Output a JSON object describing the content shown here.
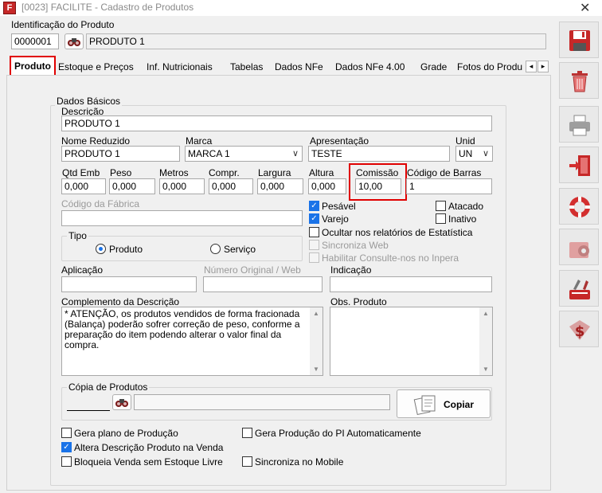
{
  "window": {
    "title": "[0023] FACILITE - Cadastro de Produtos",
    "close": "✕"
  },
  "header": {
    "section_label": "Identificação do Produto",
    "code": "0000001",
    "product_name": "PRODUTO 1"
  },
  "tabs": [
    {
      "label": "Produto"
    },
    {
      "label": "Estoque e Preços"
    },
    {
      "label": "Inf. Nutricionais"
    },
    {
      "label": "Tabelas"
    },
    {
      "label": "Dados NFe"
    },
    {
      "label": "Dados NFe 4.00"
    },
    {
      "label": "Grade"
    },
    {
      "label": "Fotos do Produ"
    }
  ],
  "tab_scroll": {
    "left": "◂",
    "right": "▸"
  },
  "basic": {
    "group_label": "Dados Básicos",
    "descricao_label": "Descrição",
    "descricao_value": "PRODUTO 1",
    "nome_reduzido_label": "Nome Reduzido",
    "nome_reduzido_value": "PRODUTO 1",
    "marca_label": "Marca",
    "marca_value": "MARCA 1",
    "apresentacao_label": "Apresentação",
    "apresentacao_value": "TESTE",
    "unid_label": "Unid",
    "unid_value": "UN",
    "qtd_emb_label": "Qtd Emb",
    "qtd_emb_value": "0,000",
    "peso_label": "Peso",
    "peso_value": "0,000",
    "metros_label": "Metros",
    "metros_value": "0,000",
    "compr_label": "Compr.",
    "compr_value": "0,000",
    "largura_label": "Largura",
    "largura_value": "0,000",
    "altura_label": "Altura",
    "altura_value": "0,000",
    "comissao_label": "Comissão",
    "comissao_value": "10,00",
    "codigo_barras_label": "Código de Barras",
    "codigo_barras_value": "1",
    "codigo_fabrica_label": "Código da Fábrica",
    "codigo_fabrica_value": ""
  },
  "checks": {
    "pesavel": {
      "label": "Pesável",
      "checked": true
    },
    "varejo": {
      "label": "Varejo",
      "checked": true
    },
    "atacado": {
      "label": "Atacado",
      "checked": false
    },
    "inativo": {
      "label": "Inativo",
      "checked": false
    },
    "ocultar": {
      "label": "Ocultar nos relatórios de Estatística",
      "checked": false
    },
    "sincroniza_web": {
      "label": "Sincroniza Web",
      "checked": false
    },
    "habilitar_consulte": {
      "label": "Habilitar Consulte-nos no Inpera",
      "checked": false
    }
  },
  "tipo": {
    "label": "Tipo",
    "produto": "Produto",
    "servico": "Serviço",
    "selected": "Produto"
  },
  "aplicacao_label": "Aplicação",
  "numero_original_label": "Número Original / Web",
  "indicacao_label": "Indicação",
  "complemento_label": "Complemento da Descrição",
  "complemento_text": "* ATENÇÃO, os produtos vendidos de forma fracionada (Balança) poderão sofrer correção de peso, conforme a preparação do item podendo alterar o valor final  da compra.",
  "obs_label": "Obs. Produto",
  "copia": {
    "label": "Cópia de Produtos",
    "code_value": "______",
    "button": "Copiar"
  },
  "bottom_checks": {
    "gera_plano": {
      "label": "Gera plano de Produção",
      "checked": false
    },
    "gera_producao_pi": {
      "label": "Gera Produção do PI Automaticamente",
      "checked": false
    },
    "altera_descricao": {
      "label": "Altera Descrição Produto na Venda",
      "checked": true
    },
    "bloqueia_venda": {
      "label": "Bloqueia Venda sem Estoque Livre",
      "checked": false
    },
    "sincroniza_mobile": {
      "label": "Sincroniza no Mobile",
      "checked": false
    }
  },
  "sidebar_icons": [
    "save-icon",
    "delete-icon",
    "print-icon",
    "exit-icon",
    "help-icon",
    "settings-icon",
    "tools-icon",
    "price-icon"
  ],
  "colors": {
    "highlight_red": "#e00000",
    "check_blue": "#1a73e8"
  }
}
